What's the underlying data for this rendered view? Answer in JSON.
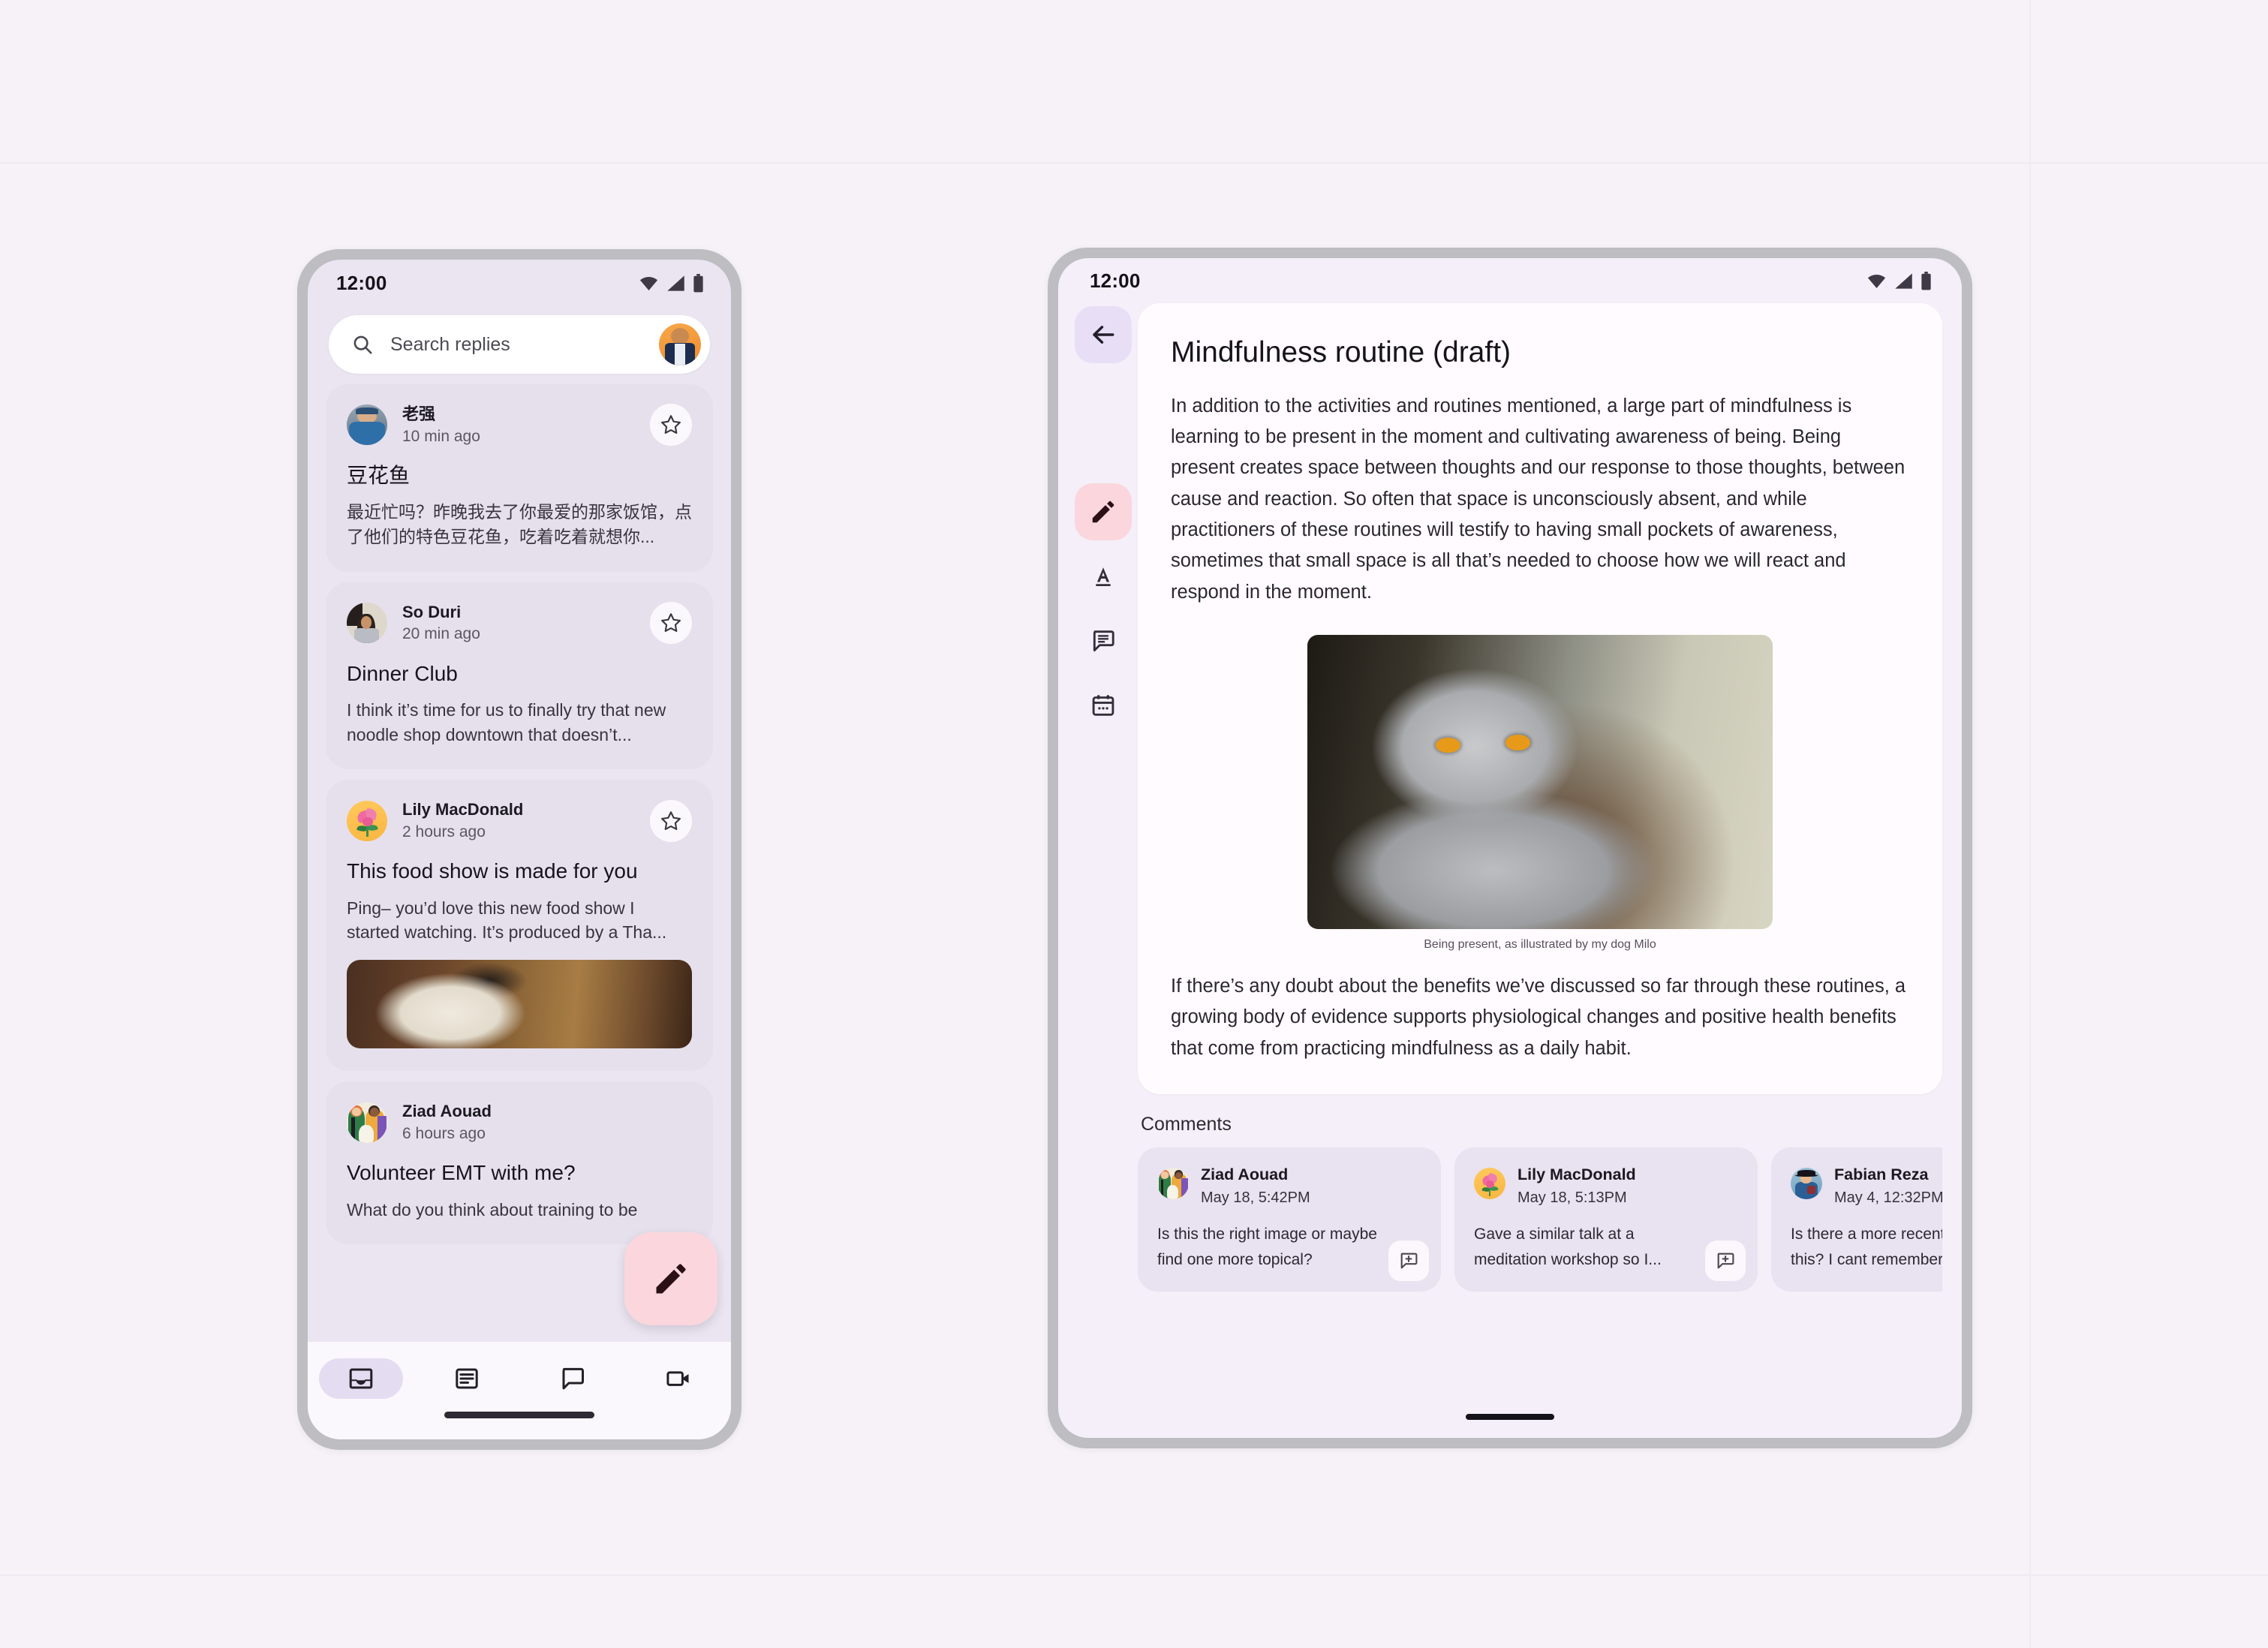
{
  "phone": {
    "status": {
      "time": "12:00",
      "icons": [
        "wifi-icon",
        "cellular-signal-icon",
        "battery-icon"
      ]
    },
    "search": {
      "placeholder": "Search replies",
      "icon": "search-icon",
      "avatar": "account-avatar"
    },
    "mail": [
      {
        "sender": "老强",
        "time": "10 min ago",
        "subject": "豆花鱼",
        "snippet": "最近忙吗？昨晚我去了你最爱的那家饭馆，点了他们的特色豆花鱼，吃着吃着就想你...",
        "starred": false,
        "has_thumb": false
      },
      {
        "sender": "So Duri",
        "time": "20 min ago",
        "subject": "Dinner Club",
        "snippet": "I think it’s time for us to finally try that new noodle shop downtown that doesn’t...",
        "starred": false,
        "has_thumb": false
      },
      {
        "sender": "Lily MacDonald",
        "time": "2 hours ago",
        "subject": "This food show is made for you",
        "snippet": "Ping– you’d love this new food show I started watching. It’s produced by a Tha...",
        "starred": false,
        "has_thumb": true
      },
      {
        "sender": "Ziad Aouad",
        "time": "6 hours ago",
        "subject": "Volunteer EMT with me?",
        "snippet": "What do you think about training to be",
        "starred": false,
        "has_thumb": false
      }
    ],
    "fab": {
      "label": "Compose",
      "icon": "pencil-icon",
      "color": "#fbd6dd"
    },
    "bottom_nav": [
      {
        "name": "inbox",
        "icon": "inbox-icon",
        "active": true
      },
      {
        "name": "articles",
        "icon": "article-icon",
        "active": false
      },
      {
        "name": "chat",
        "icon": "chat-bubble-icon",
        "active": false
      },
      {
        "name": "video",
        "icon": "video-camera-icon",
        "active": false
      }
    ]
  },
  "tablet": {
    "status": {
      "time": "12:00",
      "icons": [
        "wifi-icon",
        "cellular-signal-icon",
        "battery-icon"
      ]
    },
    "back": {
      "icon": "arrow-back-icon",
      "color": "#e8dff7"
    },
    "rail": [
      {
        "name": "edit",
        "icon": "pencil-icon",
        "active": true,
        "color": "#fbd6dd"
      },
      {
        "name": "text-format",
        "icon": "text-format-icon",
        "active": false
      },
      {
        "name": "comment",
        "icon": "comment-icon",
        "active": false
      },
      {
        "name": "calendar",
        "icon": "calendar-icon",
        "active": false
      }
    ],
    "document": {
      "title": "Mindfulness routine (draft)",
      "paragraph_1": "In addition to the activities and routines mentioned, a large part of mindfulness is learning to be present in the moment and cultivating awareness of being. Being present creates space between thoughts and our response to those thoughts, between cause and reaction. So often that space is unconsciously absent, and while practitioners of these routines will testify to having small pockets of awareness, sometimes that small space is all that’s needed to choose how we will react and respond in the moment.",
      "image_caption": "Being present, as illustrated by my dog Milo",
      "paragraph_2": "If there’s any doubt about the benefits we’ve discussed so far through these routines, a growing body of evidence supports physiological changes and positive health benefits that come from practicing mindfulness as a daily habit."
    },
    "comments": {
      "label": "Comments",
      "items": [
        {
          "author": "Ziad Aouad",
          "timestamp": "May 18, 5:42PM",
          "text_line_1": "Is this the right image or maybe",
          "text_line_2": "find one more topical?",
          "reply_icon": "add-comment-icon"
        },
        {
          "author": "Lily MacDonald",
          "timestamp": "May 18, 5:13PM",
          "text_line_1": "Gave a similar talk at a",
          "text_line_2": "meditation workshop so I...",
          "reply_icon": "add-comment-icon"
        },
        {
          "author": "Fabian Reza",
          "timestamp": "May 4, 12:32PM",
          "text_line_1": "Is there a more recent upd",
          "text_line_2": "this? I cant remember. No",
          "reply_icon": "add-comment-icon"
        }
      ]
    }
  },
  "theme": {
    "page_bg": "#f6f2f8",
    "device_frame": "#bdbdc2",
    "phone_screen_bg": "#ebe5f1",
    "tablet_screen_bg": "#f4eff8",
    "card_surface": "#e6e0ed",
    "doc_surface": "#fffbfe",
    "accent_pink": "#fbd6dd",
    "accent_lavender": "#e8dff7"
  }
}
